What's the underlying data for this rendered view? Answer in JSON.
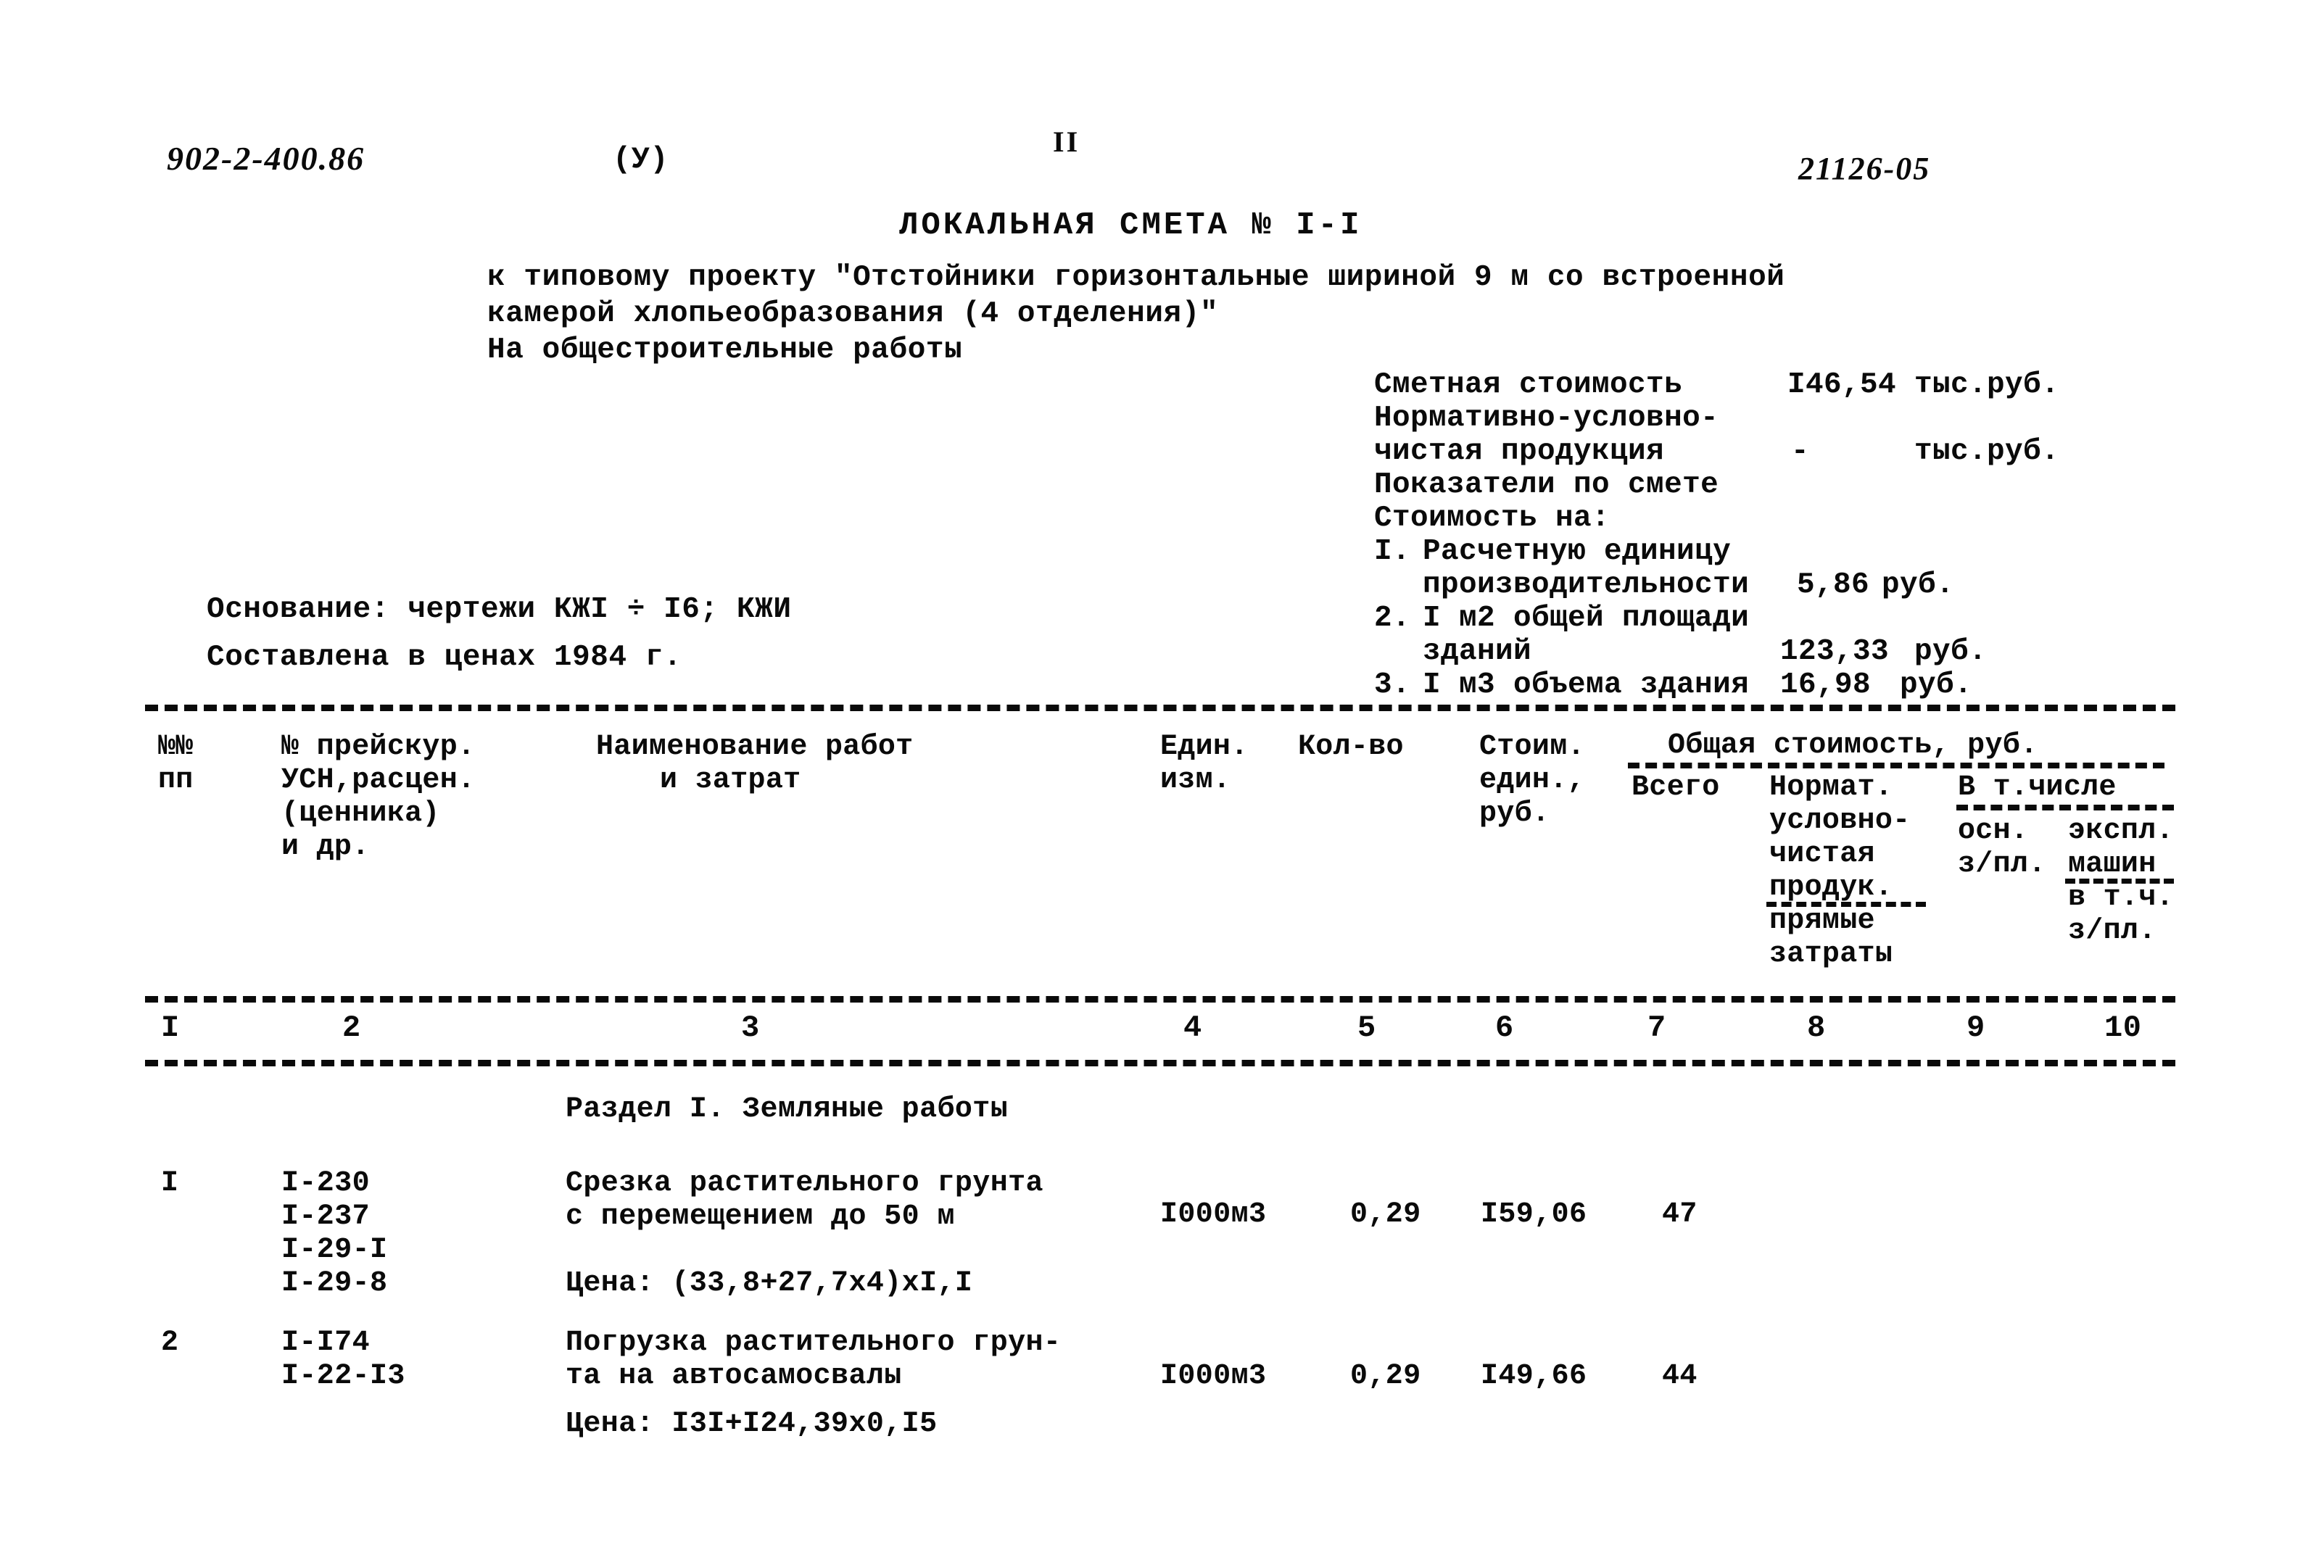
{
  "header": {
    "doc_number": "902-2-400.86",
    "variant_mark": "(У)",
    "page_folio": "II",
    "archive_number": "21126-05"
  },
  "title": {
    "main": "ЛОКАЛЬНАЯ СМЕТА № I-I",
    "line1": "к типовому проекту \"Отстойники горизонтальные шириной 9 м со встроенной",
    "line2": "камерой хлопьеобразования (4 отделения)\"",
    "line3": "На общестроительные работы"
  },
  "basis": {
    "line1": "Основание: чертежи КЖI ÷ I6; КЖИ",
    "line2": "Составлена в ценах 1984 г."
  },
  "summary": {
    "estimate_cost_label": "Сметная стоимость",
    "estimate_cost_value": "I46,54",
    "estimate_cost_unit": "тыс.руб.",
    "net_product_label_1": "Нормативно-условно-",
    "net_product_label_2": "чистая продукция",
    "net_product_value": "-",
    "net_product_unit": "тыс.руб.",
    "indicators_label": "Показатели по смете",
    "cost_for_label": "Стоимость на:",
    "items": [
      {
        "num": "I.",
        "text_line1": "Расчетную единицу",
        "text_line2": "производительности",
        "value": "5,86",
        "unit": "руб."
      },
      {
        "num": "2.",
        "text_line1": "I м2 общей площади",
        "text_line2": "зданий",
        "value": "123,33",
        "unit": "руб."
      },
      {
        "num": "3.",
        "text_line1": "I м3 объема здания",
        "text_line2": "",
        "value": "16,98",
        "unit": "руб."
      }
    ]
  },
  "table": {
    "headers": {
      "col1_l1": "№№",
      "col1_l2": "пп",
      "col2_l1": "№ прейскур.",
      "col2_l2": "УСН,расцен.",
      "col2_l3": "(ценника)",
      "col2_l4": "и др.",
      "col3_l1": "Наименование работ",
      "col3_l2": "и затрат",
      "col4_l1": "Един.",
      "col4_l2": "изм.",
      "col5_l1": "Кол-во",
      "col6_l1": "Стоим.",
      "col6_l2": "един.,",
      "col6_l3": "руб.",
      "group_total": "Общая стоимость, руб.",
      "col7_l1": "Всего",
      "col8_l1": "Нормат.",
      "col8_l2": "условно-",
      "col8_l3": "чистая",
      "col8_l4": "продук.",
      "col8_l5": "прямые",
      "col8_l6": "затраты",
      "group_incl": "В т.числе",
      "col9_l1": "осн.",
      "col9_l2": "з/пл.",
      "col10_l1": "экспл.",
      "col10_l2": "машин",
      "col10_l3": "в т.ч.",
      "col10_l4": "з/пл."
    },
    "column_numbers": [
      "I",
      "2",
      "3",
      "4",
      "5",
      "6",
      "7",
      "8",
      "9",
      "10"
    ],
    "section_title": "Раздел I. Земляные работы",
    "rows": [
      {
        "num": "I",
        "codes": [
          "I-230",
          "I-237",
          "I-29-I",
          "I-29-8"
        ],
        "name_line1": "Срезка растительного грунта",
        "name_line2": "с перемещением до 50 м",
        "price_note": "Цена: (33,8+27,7х4)хI,I",
        "unit": "I000м3",
        "qty": "0,29",
        "unit_cost": "I59,06",
        "total": "47",
        "normative": "",
        "main_wage": "",
        "machines": ""
      },
      {
        "num": "2",
        "codes": [
          "I-I74",
          "I-22-I3"
        ],
        "name_line1": "Погрузка растительного грун-",
        "name_line2": "та на автосамосвалы",
        "price_note": "Цена: I3I+I24,39х0,I5",
        "unit": "I000м3",
        "qty": "0,29",
        "unit_cost": "I49,66",
        "total": "44",
        "normative": "",
        "main_wage": "",
        "machines": ""
      }
    ]
  }
}
